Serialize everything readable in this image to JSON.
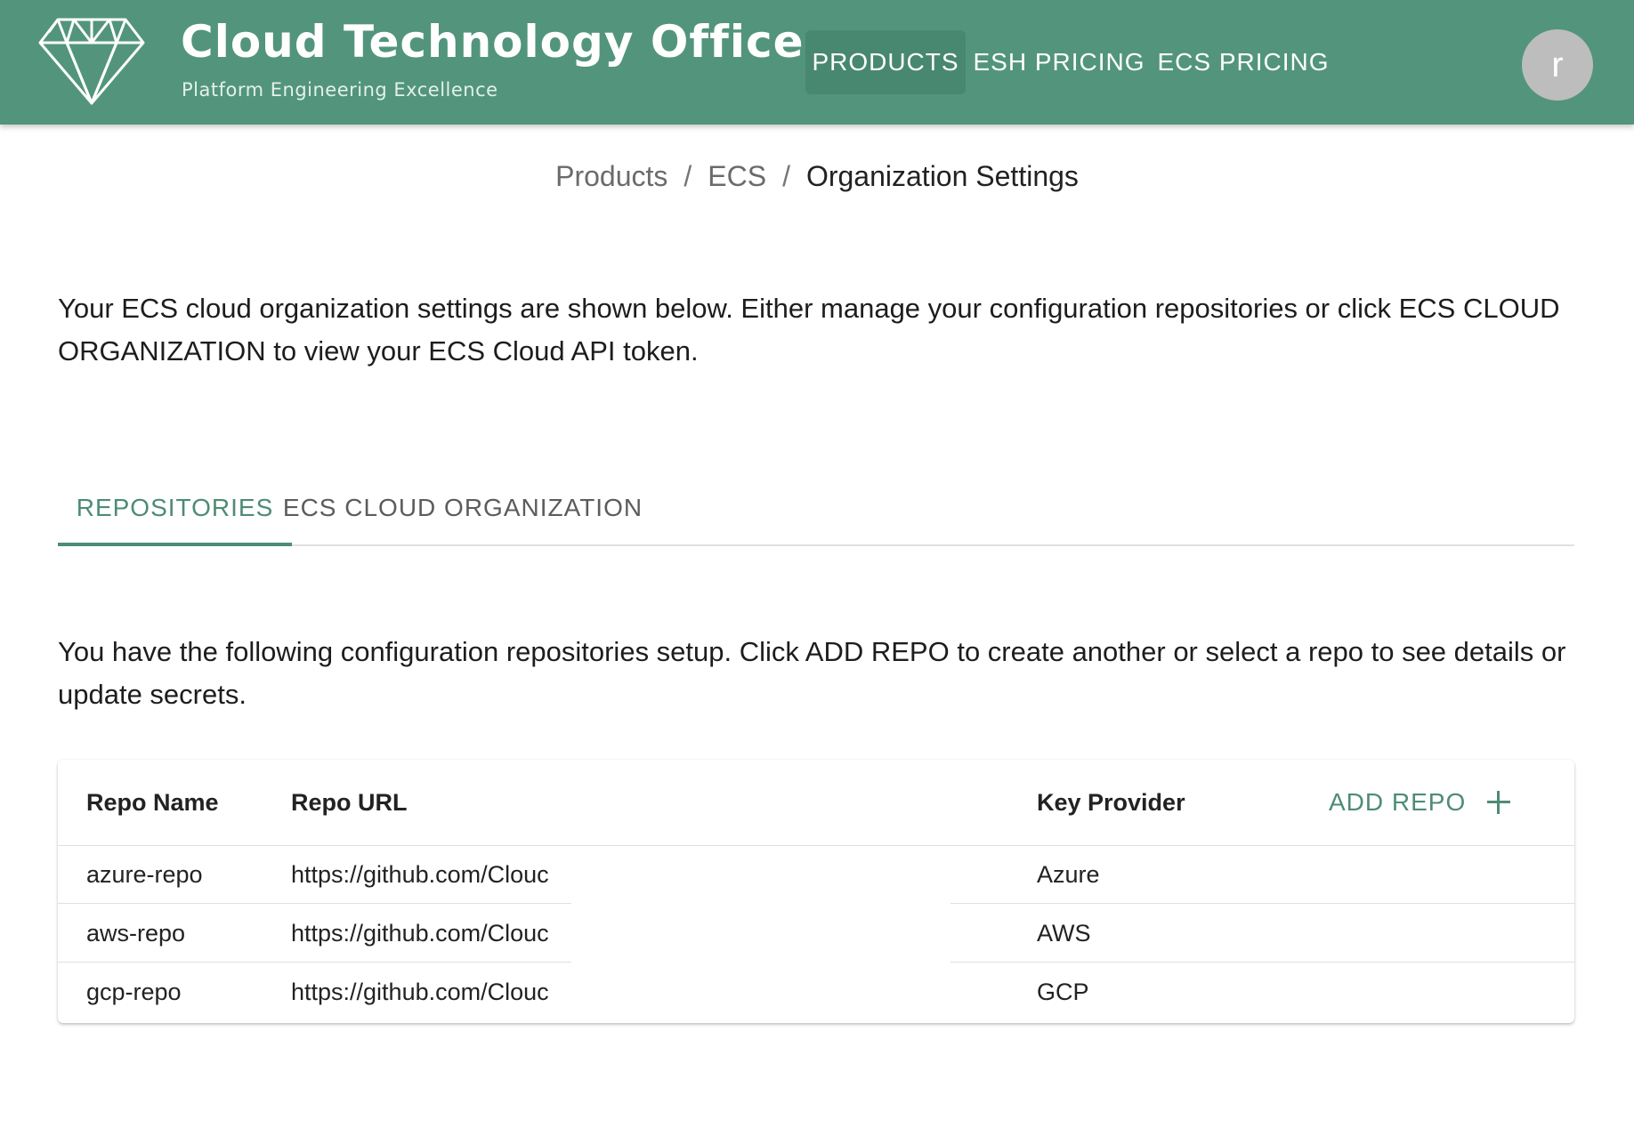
{
  "header": {
    "title": "Cloud Technology Office",
    "subtitle": "Platform Engineering Excellence",
    "nav": [
      {
        "label": "PRODUCTS",
        "active": true
      },
      {
        "label": "ESH PRICING",
        "active": false
      },
      {
        "label": "ECS PRICING",
        "active": false
      }
    ],
    "avatar_initial": "r",
    "brand_color": "#52957c",
    "logo_icon": "diamond-icon"
  },
  "breadcrumb": {
    "items": [
      "Products",
      "ECS",
      "Organization Settings"
    ],
    "separator": "/"
  },
  "intro_text": "Your ECS cloud organization settings are shown below. Either manage your configuration repositories or click ECS CLOUD ORGANIZATION to view your ECS Cloud API token.",
  "tabs": [
    {
      "label": "REPOSITORIES",
      "active": true
    },
    {
      "label": "ECS CLOUD ORGANIZATION",
      "active": false
    }
  ],
  "repositories": {
    "description": "You have the following configuration repositories setup. Click ADD REPO to create another or select a repo to see details or update secrets.",
    "columns": [
      "Repo Name",
      "Repo URL",
      "Key Provider"
    ],
    "add_label": "ADD REPO",
    "add_icon": "plus-icon",
    "rows": [
      {
        "name": "azure-repo",
        "url": "https://github.com/Clouc",
        "provider": "Azure"
      },
      {
        "name": "aws-repo",
        "url": "https://github.com/Clouc",
        "provider": "AWS"
      },
      {
        "name": "gcp-repo",
        "url": "https://github.com/Clouc",
        "provider": "GCP"
      }
    ]
  },
  "accent_color": "#4d8c74"
}
